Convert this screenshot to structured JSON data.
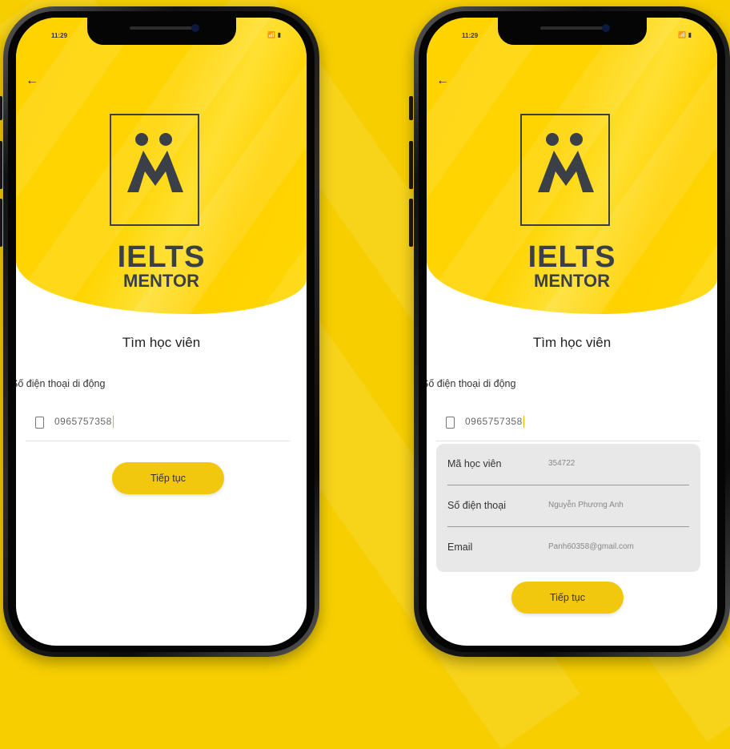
{
  "colors": {
    "background": "#f7cf00",
    "accent": "#f1c80e",
    "logo": "#3b3f48"
  },
  "left_phone": {
    "status_time": "11:29",
    "status_icons": "📶 ▮",
    "back_icon": "←",
    "brand_line1": "IELTS",
    "brand_line2": "MENTOR",
    "title": "Tìm học viên",
    "phone_label": "Số điện thoại di động",
    "phone_value": "0965757358",
    "continue_label": "Tiếp tục"
  },
  "right_phone": {
    "status_time": "11:29",
    "status_icons": "📶 ▮",
    "back_icon": "←",
    "brand_line1": "IELTS",
    "brand_line2": "MENTOR",
    "title": "Tìm học viên",
    "phone_label": "Số điện thoại di động",
    "phone_value": "0965757358",
    "info": {
      "rows": [
        {
          "label": "Mã học viên",
          "value": "354722"
        },
        {
          "label": "Số điện thoại",
          "value": "Nguyễn Phương Anh"
        },
        {
          "label": "Email",
          "value": "Panh60358@gmail.com"
        }
      ]
    },
    "continue_label": "Tiếp tục"
  }
}
